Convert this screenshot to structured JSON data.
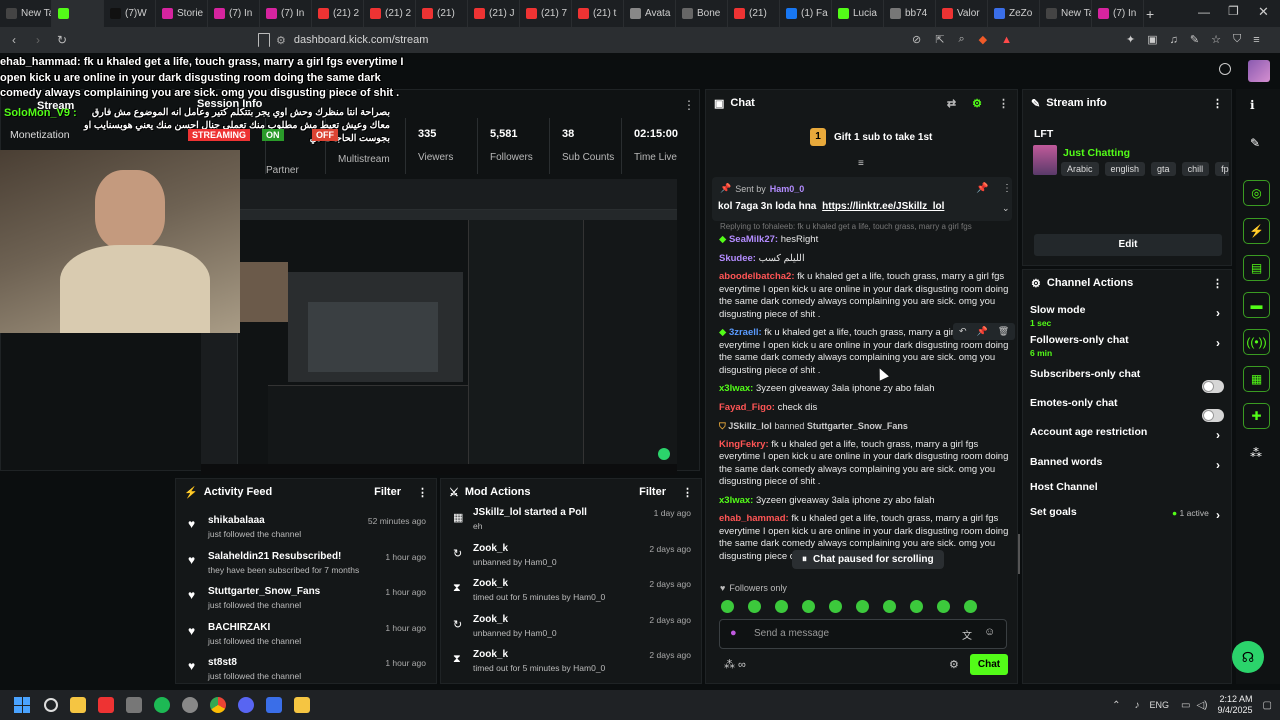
{
  "browser": {
    "tabs": [
      "New Tab",
      "",
      "(7)W",
      "Storie",
      "(7) In",
      "(7) In",
      "(21) 2",
      "(21) 2",
      "(21)",
      "(21) J",
      "(21) 7",
      "(21) t",
      "Avata",
      "Bone",
      "(21)",
      "(1) Fa",
      "Lucia",
      "bb74",
      "Valor",
      "ZeZo",
      "New Tab",
      "(7) In"
    ],
    "url": "dashboard.kick.com/stream"
  },
  "overlay": {
    "caption": "ehab_hammad: fk u khaled get a life, touch grass, marry a girl fgs everytime I open kick u are online in your dark disgusting room doing the same dark comedy always complaining you are sick. omg you disgusting piece of shit .",
    "arabic_user": "SoloMon_V9 :",
    "arabic_text": "بصراحة انتا منظرك وحش اوي يجر بتتكلم كتير وعامل انه الموضوع مش فارق معاك وعيش تعيط مش مطلوب منك تعملي جنال احسن منك يعني هوبسنايب او بجوست الحاجات دي"
  },
  "dashboard": {
    "stream_label": "Stream",
    "session_info": "Session Info",
    "monetization": "Monetization",
    "streaming_badge": "STREAMING",
    "on_badge": "ON",
    "off_badge": "OFF",
    "preview_label": "review",
    "partner_income": "Partner Income",
    "multistream": "Multistream",
    "stats": [
      {
        "value": "335",
        "label": "Viewers"
      },
      {
        "value": "5,581",
        "label": "Followers"
      },
      {
        "value": "38",
        "label": "Sub Counts"
      },
      {
        "value": "02:15:00",
        "label": "Time Live"
      }
    ]
  },
  "chat": {
    "title": "Chat",
    "gift_text": "Gift 1 sub to take 1st",
    "pinned": {
      "sent_by": "Sent by",
      "user": "Ham0_0",
      "text": "kol 7aga 3n loda hna",
      "link": "https://linktr.ee/JSkillz_lol"
    },
    "replying": "Replying to fohaleeb: fk u khaled get a life, touch grass, marry a girl fgs",
    "messages": [
      {
        "user": "SeaMilk27:",
        "text": "hesRight",
        "color": "#b38cff"
      },
      {
        "user": "Skudee:",
        "text": "الليلم كسب",
        "color": "#b38cff"
      },
      {
        "user": "aboodelbatcha2:",
        "text": "fk u khaled get a life, touch grass, marry a girl fgs everytime I open kick u are online in your dark disgusting room doing the same dark comedy always complaining you are sick. omg you disgusting piece of shit .",
        "color": "#ff5555"
      },
      {
        "user": "3zraell:",
        "text": "fk u khaled get a life, touch grass, marry a girl fgs everytime I open kick u are online in your dark disgusting room doing the same dark comedy always complaining you are sick. omg you disgusting piece of shit .",
        "color": "#5a9bff"
      },
      {
        "user": "x3lwax:",
        "text": "3yzeen giveaway 3ala iphone zy abo falah",
        "color": "#53fc18"
      },
      {
        "user": "Fayad_Figo:",
        "text": "check dis",
        "color": "#ff5555"
      },
      {
        "user": "KingFekry:",
        "text": "fk u khaled get a life, touch grass, marry a girl fgs everytime I open kick u are online in your dark disgusting room doing the same dark comedy always complaining you are sick. omg you disgusting piece of shit .",
        "color": "#ff5555"
      },
      {
        "user": "x3lwax:",
        "text": "3yzeen giveaway 3ala iphone zy abo falah",
        "color": "#53fc18"
      },
      {
        "user": "ehab_hammad:",
        "text": "fk u khaled get a life, touch grass, marry a girl fgs everytime I open kick u are online in your dark disgusting room doing the same dark comedy always complaining you are sick. omg you disgusting piece of shit .",
        "color": "#ff5555"
      }
    ],
    "ban_notice": {
      "user": "JSkillz_lol",
      "action": "banned",
      "target": "Stuttgarter_Snow_Fans"
    },
    "paused": "Chat paused for scrolling",
    "followers_only": "Followers only",
    "placeholder": "Send a message",
    "send": "Chat"
  },
  "stream_info": {
    "title": "Stream info",
    "stream_title": "LFT",
    "category": "Just Chatting",
    "tags": [
      "Arabic",
      "english",
      "gta",
      "chill",
      "fps"
    ],
    "edit": "Edit"
  },
  "channel_actions": {
    "title": "Channel Actions",
    "items": [
      {
        "label": "Slow mode",
        "sub": "1 sec"
      },
      {
        "label": "Followers-only chat",
        "sub": "6 min"
      },
      {
        "label": "Subscribers-only chat",
        "sub": ""
      },
      {
        "label": "Emotes-only chat",
        "sub": ""
      },
      {
        "label": "Account age restriction",
        "sub": ""
      },
      {
        "label": "Banned words",
        "sub": ""
      },
      {
        "label": "Host Channel",
        "sub": ""
      },
      {
        "label": "Set goals",
        "sub": "1 active"
      }
    ]
  },
  "activity_feed": {
    "title": "Activity Feed",
    "filter": "Filter",
    "items": [
      {
        "user": "shikabalaaa",
        "text": "just followed the channel",
        "time": "52 minutes ago"
      },
      {
        "user": "Salaheldin21 Resubscribed!",
        "text": "they have been subscribed for 7 months",
        "time": "1 hour ago"
      },
      {
        "user": "Stuttgarter_Snow_Fans",
        "text": "just followed the channel",
        "time": "1 hour ago"
      },
      {
        "user": "BACHIRZAKI",
        "text": "just followed the channel",
        "time": "1 hour ago"
      },
      {
        "user": "st8st8",
        "text": "just followed the channel",
        "time": "1 hour ago"
      }
    ]
  },
  "mod_actions": {
    "title": "Mod Actions",
    "filter": "Filter",
    "items": [
      {
        "user": "JSkillz_lol started a Poll",
        "text": "eh",
        "time": "1 day ago"
      },
      {
        "user": "Zook_k",
        "text": "unbanned by Ham0_0",
        "time": "2 days ago"
      },
      {
        "user": "Zook_k",
        "text": "timed out for 5 minutes by Ham0_0",
        "time": "2 days ago"
      },
      {
        "user": "Zook_k",
        "text": "unbanned by Ham0_0",
        "time": "2 days ago"
      },
      {
        "user": "Zook_k",
        "text": "timed out for 5 minutes by Ham0_0",
        "time": "2 days ago"
      }
    ]
  },
  "taskbar": {
    "lang": "ENG",
    "time": "2:12 AM",
    "date": "9/4/2025"
  }
}
